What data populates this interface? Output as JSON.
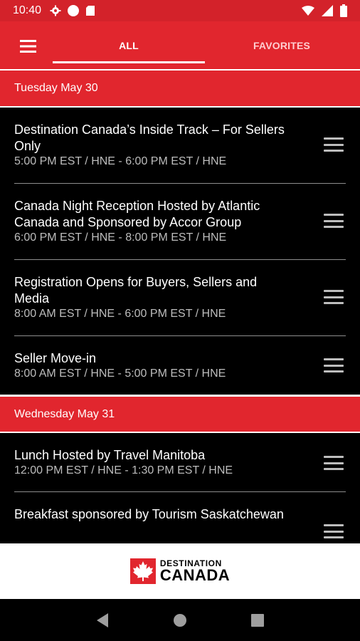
{
  "status_bar": {
    "time": "10:40",
    "icons_left": [
      "gear-icon",
      "circle-icon",
      "sd-card-icon"
    ],
    "icons_right": [
      "wifi-icon",
      "signal-icon",
      "battery-icon"
    ]
  },
  "app_bar": {
    "menu_icon": "hamburger-icon",
    "tabs": [
      {
        "label": "ALL",
        "selected": true
      },
      {
        "label": "FAVORITES",
        "selected": false
      }
    ]
  },
  "schedule": [
    {
      "day": "Tuesday May 30",
      "events": [
        {
          "title": "Destination Canada’s Inside Track – For Sellers Only",
          "time": "5:00 PM EST / HNE - 6:00 PM EST / HNE"
        },
        {
          "title": "Canada Night Reception Hosted by Atlantic Canada and Sponsored by Accor Group",
          "time": "6:00 PM EST / HNE - 8:00 PM EST / HNE"
        },
        {
          "title": "Registration Opens for Buyers, Sellers and Media",
          "time": "8:00 AM EST / HNE - 6:00 PM EST / HNE"
        },
        {
          "title": "Seller Move-in",
          "time": "8:00 AM EST / HNE - 5:00 PM EST / HNE"
        }
      ]
    },
    {
      "day": "Wednesday May 31",
      "events": [
        {
          "title": "Lunch Hosted by Travel Manitoba",
          "time": "12:00 PM EST / HNE - 1:30 PM EST / HNE"
        },
        {
          "title": "Breakfast sponsored by Tourism Saskatchewan",
          "time": ""
        }
      ]
    }
  ],
  "footer": {
    "logo_line1": "DESTINATION",
    "logo_line2": "CANADA",
    "logo_icon": "maple-leaf-icon",
    "brand_color": "#e1262e"
  },
  "nav_bar": {
    "icons": [
      "back-icon",
      "home-icon",
      "recents-icon"
    ]
  }
}
